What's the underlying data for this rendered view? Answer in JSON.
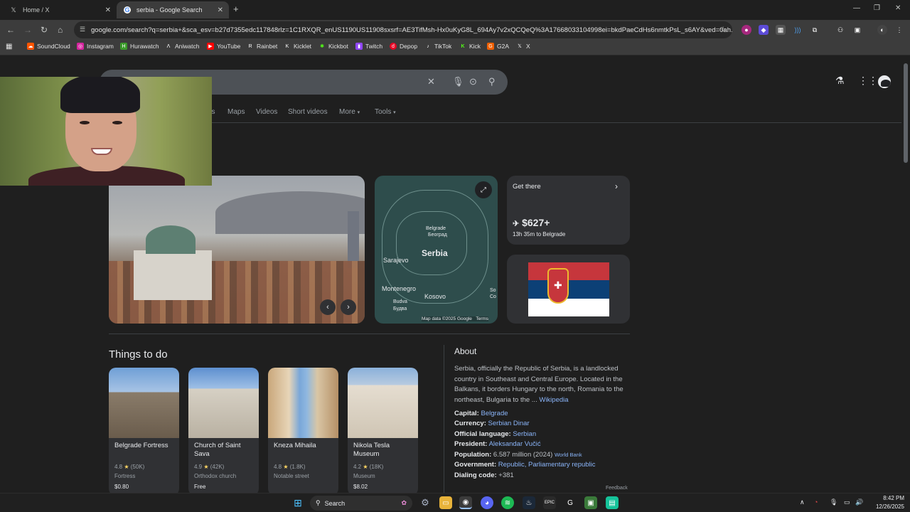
{
  "browser": {
    "tabs": [
      {
        "title": "Home / X",
        "icon": "x-logo-icon"
      },
      {
        "title": "serbia - Google Search",
        "icon": "google-icon"
      }
    ],
    "url": "google.com/search?q=serbia+&sca_esv=b27d7355edc117848rlz=1C1RXQR_enUS1190US11908sxsrf=AE3TifMsh-Hx0uKyG8L_694Ay7v2xQCQeQ%3A17668033104998ei=bkdPaeCdHs6nmtkPsL_s6AY&ved=0ah...",
    "bookmarks": [
      "SoundCloud",
      "Instagram",
      "Hurawatch",
      "Aniwatch",
      "YouTube",
      "Rainbet",
      "Kicklet",
      "Kickbot",
      "Twitch",
      "Depop",
      "TikTok",
      "Kick",
      "G2A",
      "X"
    ]
  },
  "search": {
    "tabs": [
      "es",
      "Maps",
      "Videos",
      "Short videos",
      "More",
      "Tools"
    ]
  },
  "knowledge": {
    "map": {
      "labels": [
        "Belgrade",
        "Београд",
        "Serbia",
        "Sarajevo",
        "Montenegro",
        "Kosovo",
        "Budva",
        "Будва",
        "So",
        "Co"
      ],
      "attribution": "Map data ©2025 Google",
      "terms": "Terms"
    },
    "getthere": {
      "title": "Get there",
      "price": "$627+",
      "duration": "13h 35m to Belgrade"
    }
  },
  "things_to_do": {
    "heading": "Things to do",
    "items": [
      {
        "name": "Belgrade Fortress",
        "rating": "4.8",
        "reviews": "(50K)",
        "type": "Fortress",
        "price": "$0.80"
      },
      {
        "name": "Church of Saint Sava",
        "rating": "4.9",
        "reviews": "(42K)",
        "type": "Orthodox church",
        "price": "Free"
      },
      {
        "name": "Kneza Mihaila",
        "rating": "4.8",
        "reviews": "(1.8K)",
        "type": "Notable street",
        "price": ""
      },
      {
        "name": "Nikola Tesla Museum",
        "rating": "4.2",
        "reviews": "(18K)",
        "type": "Museum",
        "price": "$8.02"
      }
    ]
  },
  "about": {
    "heading": "About",
    "description": "Serbia, officially the Republic of Serbia, is a landlocked country in Southeast and Central Europe. Located in the Balkans, it borders Hungary to the north, Romania to the northeast, Bulgaria to the ...",
    "wiki": "Wikipedia",
    "facts": [
      {
        "label": "Capital:",
        "value": "Belgrade"
      },
      {
        "label": "Currency:",
        "value": "Serbian Dinar"
      },
      {
        "label": "Official language:",
        "value": "Serbian"
      },
      {
        "label": "President:",
        "value": "Aleksandar Vučić"
      },
      {
        "label": "Population:",
        "value": "6.587 million (2024)",
        "source": "World Bank"
      },
      {
        "label": "Government:",
        "value": "Republic, Parliamentary republic"
      },
      {
        "label": "Dialing code:",
        "value": "+381"
      }
    ],
    "feedback": "Feedback"
  },
  "taskbar": {
    "search": "Search",
    "time": "8:42 PM",
    "date": "12/26/2025"
  },
  "colors": {
    "accent": "#8ab4f8",
    "star": "#fdd663",
    "serbia_red": "#c6363c",
    "serbia_blue": "#0c4076"
  }
}
